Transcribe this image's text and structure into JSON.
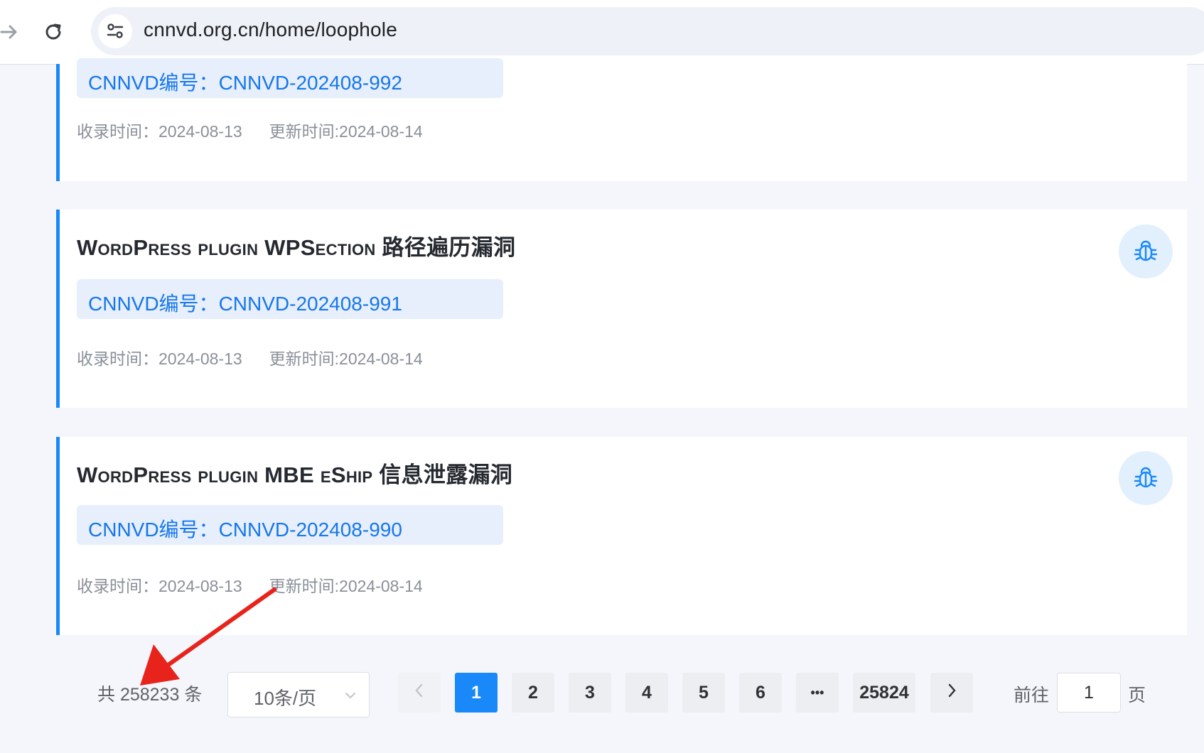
{
  "browser": {
    "url": "cnnvd.org.cn/home/loophole"
  },
  "vulns": [
    {
      "title": "",
      "id_label": "CNNVD编号：",
      "id": "CNNVD-202408-992",
      "collected_label": "收录时间：",
      "collected": "2024-08-13",
      "updated_label": "更新时间: ",
      "updated": "2024-08-14"
    },
    {
      "title": "WordPress plugin WPSection 路径遍历漏洞",
      "id_label": "CNNVD编号：",
      "id": "CNNVD-202408-991",
      "collected_label": "收录时间：",
      "collected": "2024-08-13",
      "updated_label": "更新时间: ",
      "updated": "2024-08-14"
    },
    {
      "title": "WordPress plugin MBE eShip 信息泄露漏洞",
      "id_label": "CNNVD编号：",
      "id": "CNNVD-202408-990",
      "collected_label": "收录时间：",
      "collected": "2024-08-13",
      "updated_label": "更新时间: ",
      "updated": "2024-08-14"
    }
  ],
  "icons": {
    "back": "arrow-right-icon",
    "reload": "reload-icon",
    "site_info": "tune-icon",
    "vuln": "bug-icon",
    "prev": "chevron-left-icon",
    "next": "chevron-right-icon",
    "select": "chevron-down-icon",
    "annotation": "red-arrow"
  },
  "pagination": {
    "total_text": "共 258233 条",
    "page_size": "10条/页",
    "pages": [
      "1",
      "2",
      "3",
      "4",
      "5",
      "6",
      "•••",
      "25824"
    ],
    "current": "1",
    "goto_label": "前往",
    "goto_value": "1",
    "goto_suffix": "页"
  },
  "colors": {
    "accent": "#1989fa",
    "id_tag_bg": "#e7effd",
    "id_text": "#1677ea",
    "annotation": "#e8231c"
  }
}
